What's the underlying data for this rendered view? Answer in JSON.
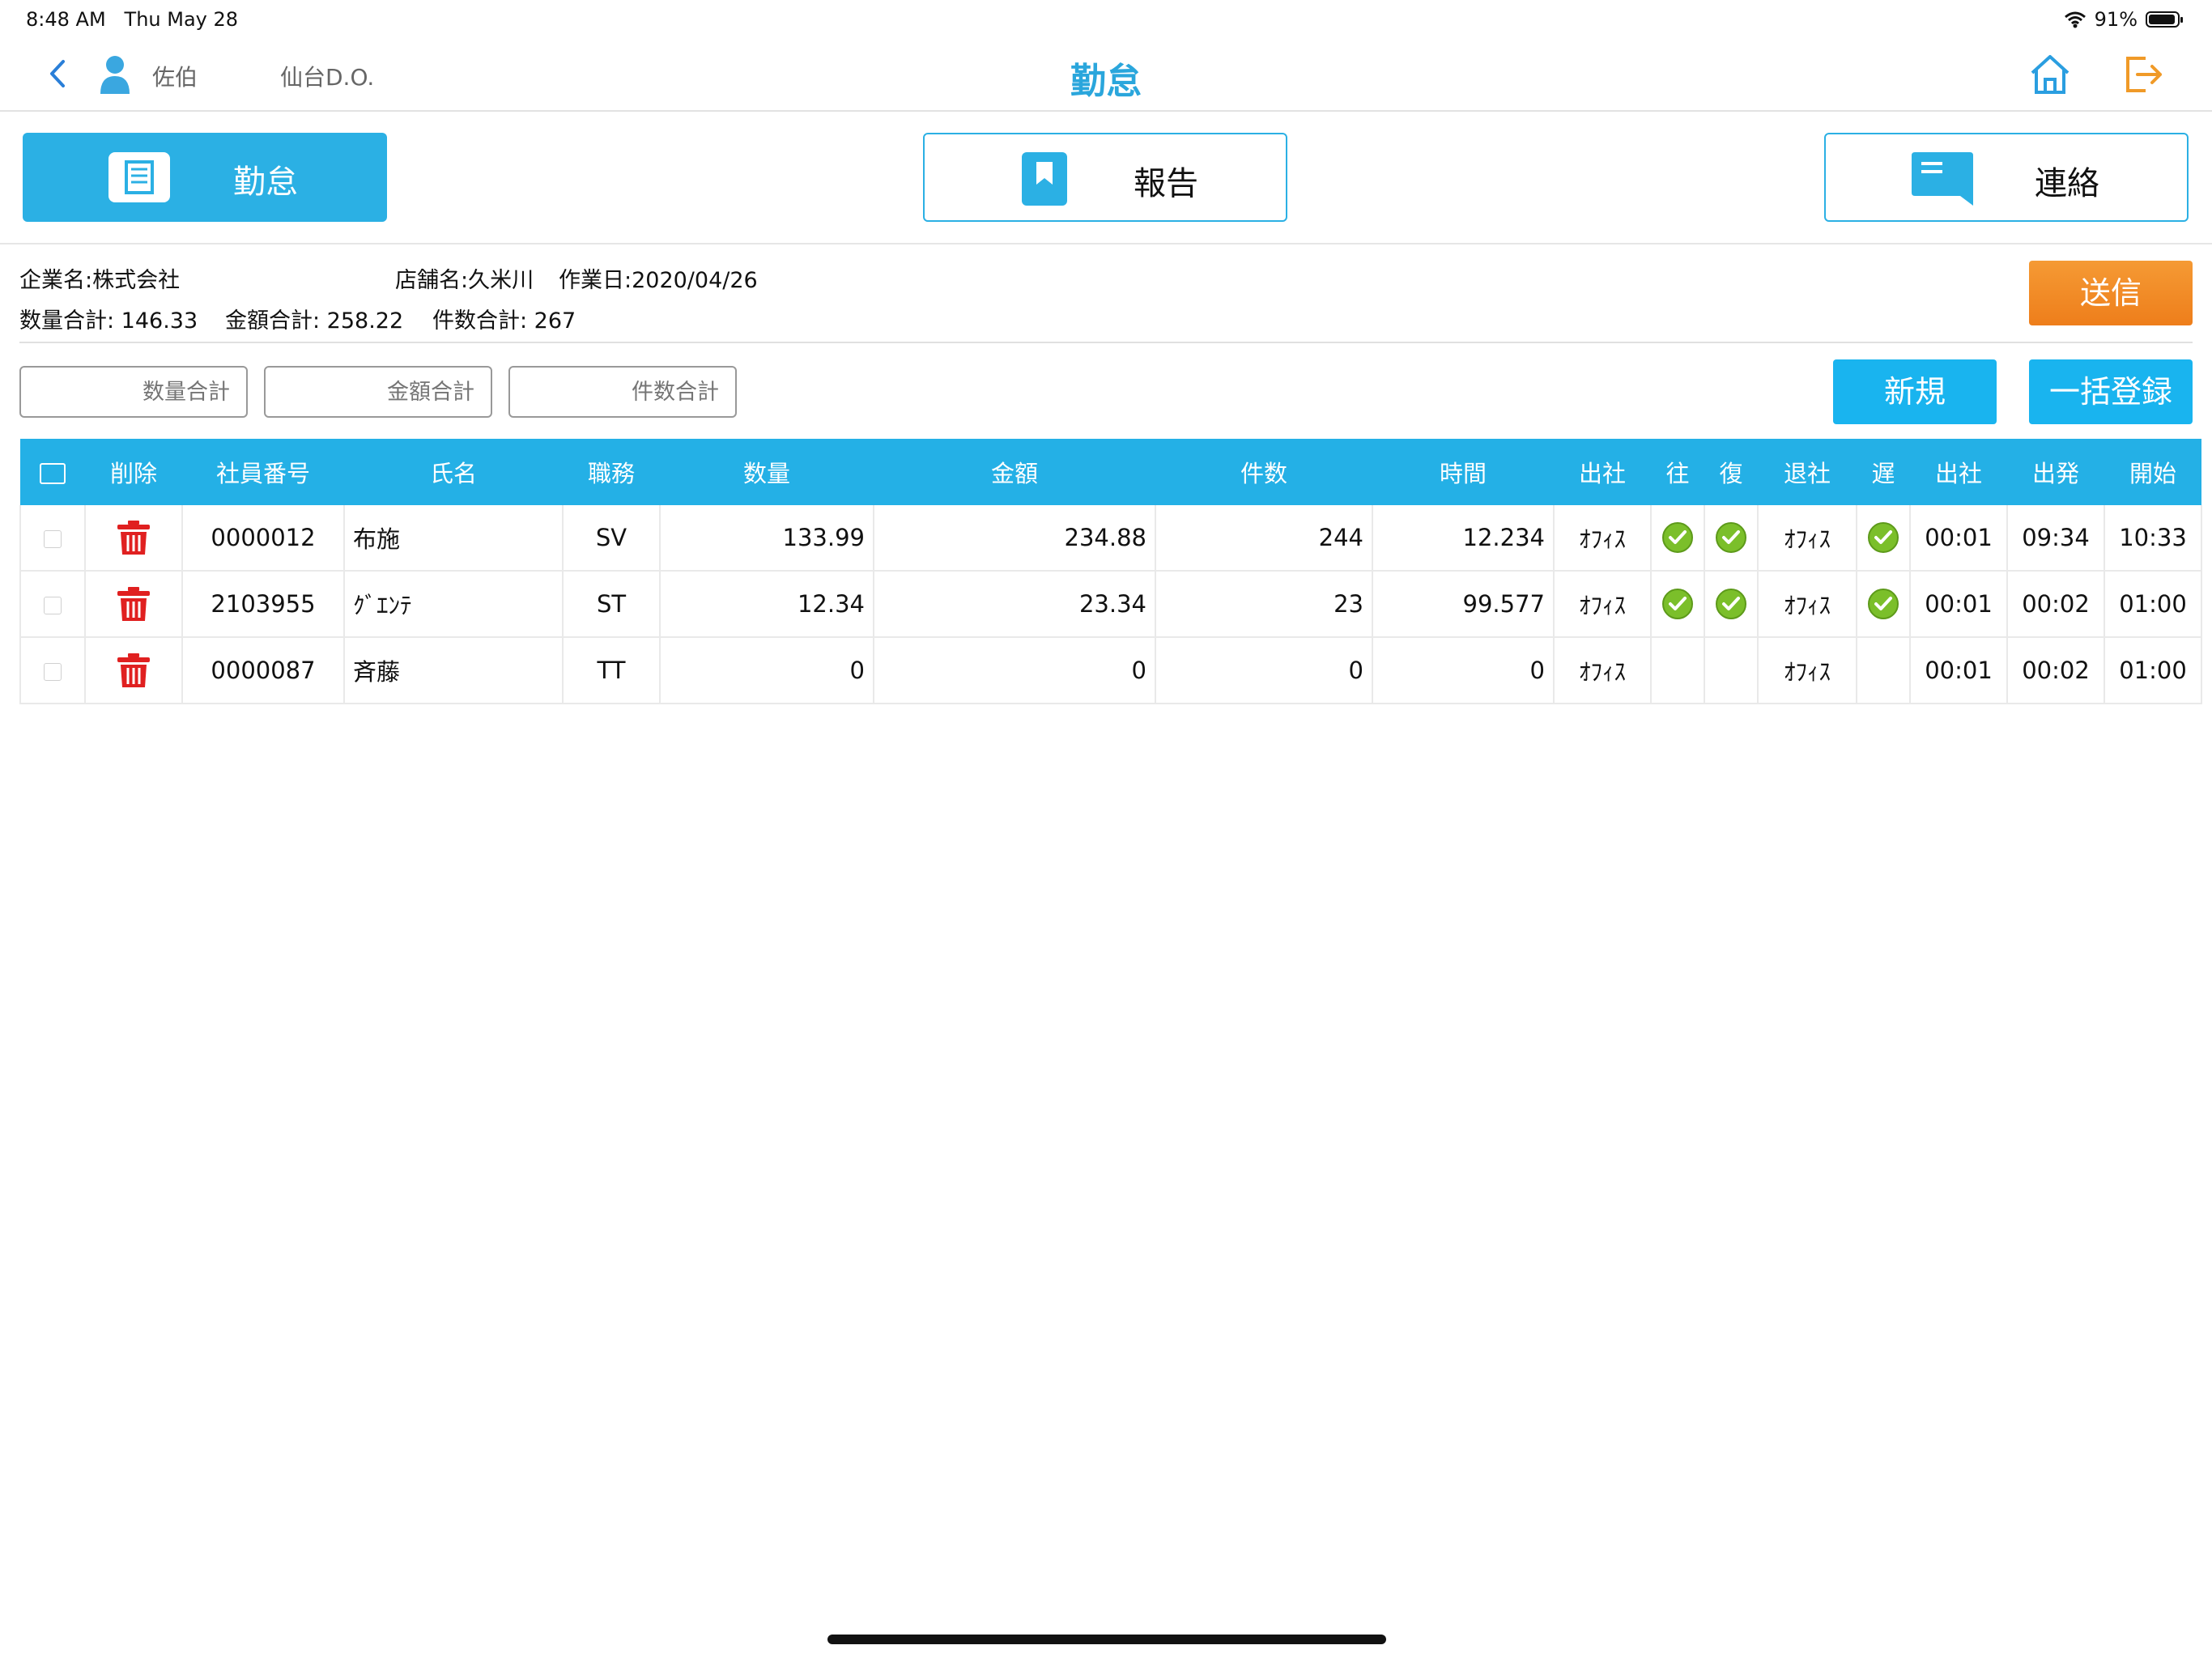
{
  "status_bar": {
    "time": "8:48 AM",
    "date": "Thu May 28",
    "battery": "91%"
  },
  "nav": {
    "user": "佐伯",
    "office": "仙台D.O.",
    "title": "勤怠"
  },
  "tabs": [
    {
      "label": "勤怠",
      "icon": "list-icon"
    },
    {
      "label": "報告",
      "icon": "bookmark-icon"
    },
    {
      "label": "連絡",
      "icon": "chat-bubble-icon"
    }
  ],
  "info": {
    "company": "企業名:株式会社",
    "store": "店舗名:久米川",
    "work_date": "作業日:2020/04/26",
    "qty_total": "数量合計: 146.33",
    "amount_total": "金額合計: 258.22",
    "count_total": "件数合計: 267"
  },
  "buttons": {
    "send": "送信",
    "new": "新規",
    "bulk_register": "一括登録"
  },
  "inputs": {
    "qty_placeholder": "数量合計",
    "amount_placeholder": "金額合計",
    "count_placeholder": "件数合計"
  },
  "table": {
    "headers": [
      "",
      "削除",
      "社員番号",
      "氏名",
      "職務",
      "数量",
      "金額",
      "件数",
      "時間",
      "出社",
      "往",
      "復",
      "退社",
      "遅",
      "出社",
      "出発",
      "開始"
    ],
    "rows": [
      {
        "emp_no": "0000012",
        "name": "布施",
        "duty": "SV",
        "qty": "133.99",
        "amount": "234.88",
        "count": "244",
        "time": "12.234",
        "in_loc": "ｵﾌｨｽ",
        "go": true,
        "back": true,
        "out_loc": "ｵﾌｨｽ",
        "late": true,
        "in_time": "00:01",
        "depart": "09:34",
        "start": "10:33"
      },
      {
        "emp_no": "2103955",
        "name": "ｸﾞｴﾝﾃ",
        "duty": "ST",
        "qty": "12.34",
        "amount": "23.34",
        "count": "23",
        "time": "99.577",
        "in_loc": "ｵﾌｨｽ",
        "go": true,
        "back": true,
        "out_loc": "ｵﾌｨｽ",
        "late": true,
        "in_time": "00:01",
        "depart": "00:02",
        "start": "01:00"
      },
      {
        "emp_no": "0000087",
        "name": "斉藤",
        "duty": "TT",
        "qty": "0",
        "amount": "0",
        "count": "0",
        "time": "0",
        "in_loc": "ｵﾌｨｽ",
        "go": false,
        "back": false,
        "out_loc": "ｵﾌｨｽ",
        "late": false,
        "in_time": "00:01",
        "depart": "00:02",
        "start": "01:00"
      }
    ]
  },
  "colors": {
    "accent": "#24b0e6",
    "send": "#f08a22",
    "delete": "#e02020",
    "check_ok": "#7bbf2a",
    "title": "#2aa6dc"
  }
}
